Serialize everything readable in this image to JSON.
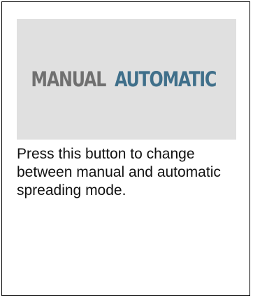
{
  "mode_toggle": {
    "manual_label": "MANUAL",
    "automatic_label": "AUTOMATIC",
    "active_mode": "automatic"
  },
  "help": {
    "description": "Press this button to change between manual and automatic spreading mode."
  },
  "colors": {
    "manual_text": "#707070",
    "automatic_text": "#3f6f8a",
    "button_background": "#e0e0e0",
    "divider": "#9aaebb"
  }
}
